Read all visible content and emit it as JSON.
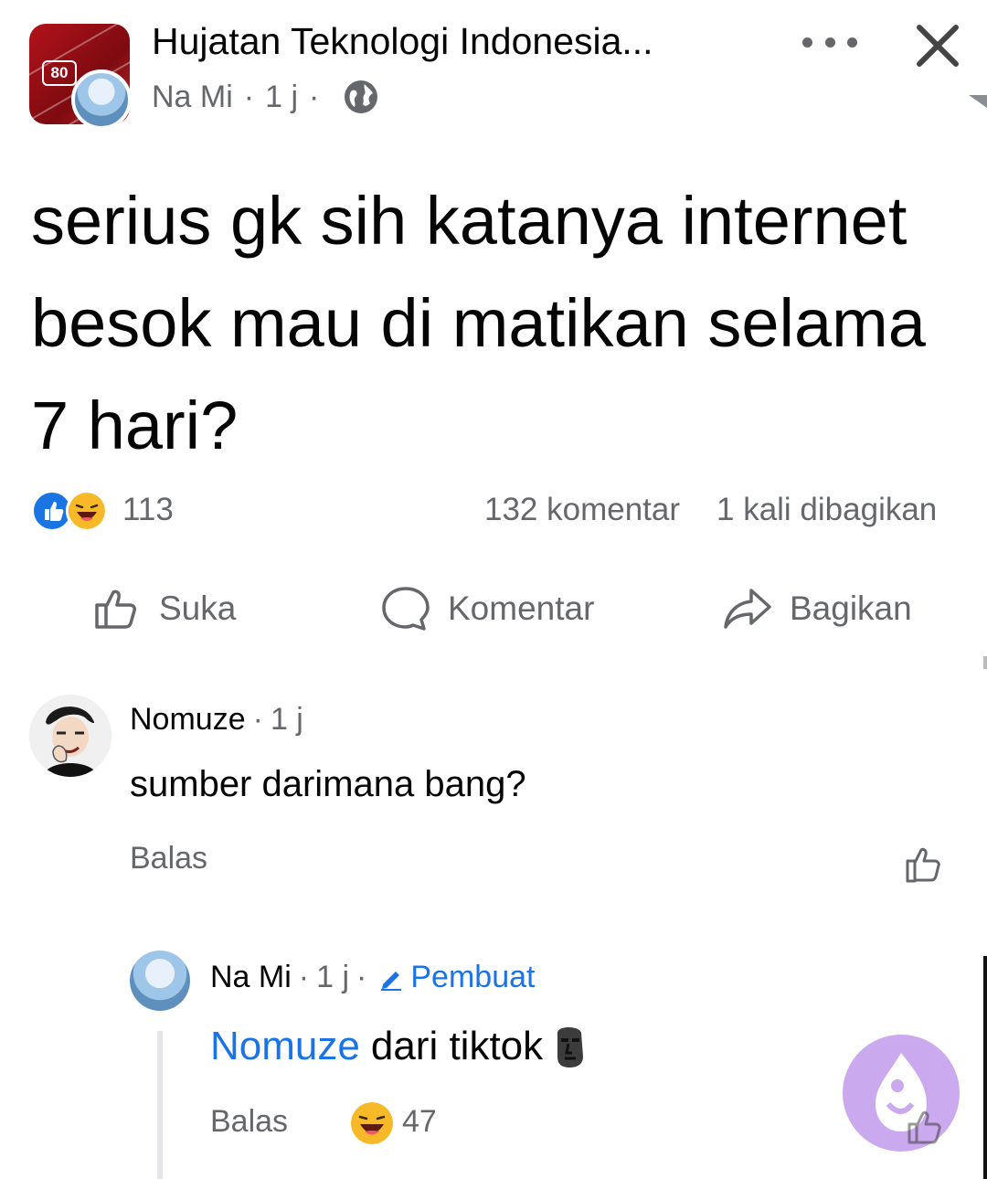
{
  "post": {
    "group_name": "Hujatan Teknologi Indonesia...",
    "group_avatar_badge": "80",
    "author": "Na Mi",
    "time": "1 j",
    "separator": "·",
    "privacy_icon": "globe-icon",
    "text": "serius gk sih katanya internet besok mau di matikan selama 7 hari?"
  },
  "stats": {
    "reaction_icons": [
      "like-reaction-icon",
      "haha-reaction-icon"
    ],
    "reaction_count": "113",
    "comment_count": "132 komentar",
    "share_count": "1 kali dibagikan"
  },
  "actions": {
    "like": "Suka",
    "comment": "Komentar",
    "share": "Bagikan"
  },
  "comments": [
    {
      "author": "Nomuze",
      "time": "1 j",
      "text": "sumber darimana bang?",
      "reply_label": "Balas"
    },
    {
      "author": "Na Mi",
      "time": "1 j",
      "badge": "Pembuat",
      "mention": "Nomuze",
      "text": "dari tiktok",
      "reply_label": "Balas",
      "reaction_icon": "haha-reaction-icon",
      "reaction_count": "47"
    }
  ],
  "colors": {
    "accent": "#1b74e4",
    "secondary_text": "#65676b",
    "group_avatar": "#b3121b",
    "fab": "#c9a5ee"
  }
}
